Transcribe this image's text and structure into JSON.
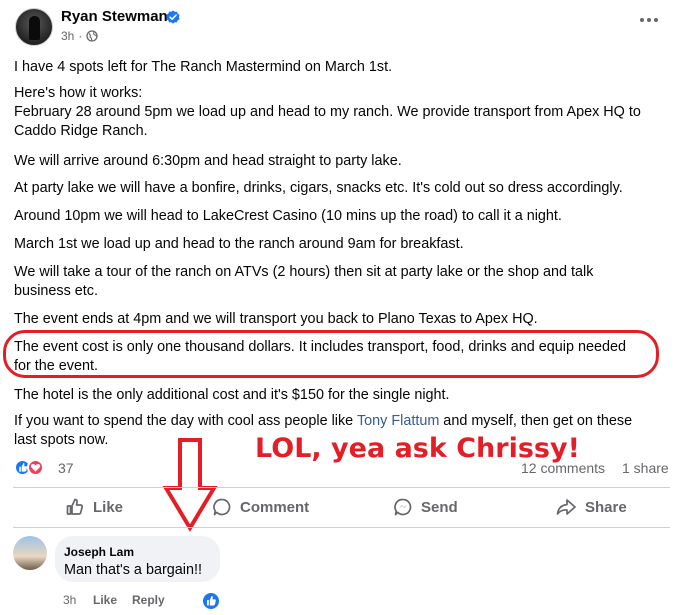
{
  "post": {
    "author": "Ryan Stewman",
    "time": "3h",
    "paragraphs": [
      [
        "I have 4 spots left for The Ranch Mastermind on March 1st."
      ],
      [
        "Here's how it works:",
        "February 28 around 5pm we load up and head to my ranch. We provide transport from Apex HQ to",
        "Caddo Ridge Ranch."
      ],
      [
        "We will arrive around 6:30pm and head straight to party lake."
      ],
      [
        "At party lake we will have a bonfire, drinks, cigars, snacks etc. It's cold out so dress accordingly."
      ],
      [
        "Around 10pm we will head to LakeCrest Casino (10 mins up the road) to call it a night."
      ],
      [
        "March 1st we load up and head to the ranch around 9am for breakfast."
      ],
      [
        "We will take a tour of the ranch on ATVs (2 hours) then sit at party lake or the shop and talk",
        "business etc."
      ],
      [
        "The event ends at 4pm and we will transport you back to Plano Texas to Apex HQ."
      ],
      [
        "The event cost is only one thousand dollars. It includes transport, food, drinks and equip needed",
        "for the event."
      ],
      [
        "The hotel is the only additional cost and it's $150 for the single night."
      ]
    ],
    "last_paragraph": {
      "before": "If you want to spend the day with cool ass people like ",
      "mention": "Tony Flattum",
      "after": " and myself, then get on these",
      "line2": "last spots now."
    }
  },
  "annotation": {
    "text": "LOL, yea ask Chrissy!",
    "color": "#e41e26"
  },
  "stats": {
    "reactions": "37",
    "comments": "12 comments",
    "shares": "1 share"
  },
  "actions": {
    "like": "Like",
    "comment": "Comment",
    "send": "Send",
    "share": "Share"
  },
  "comment": {
    "author": "Joseph Lam",
    "text": "Man that's a bargain!!",
    "time": "3h",
    "like": "Like",
    "reply": "Reply"
  },
  "colors": {
    "facebook_blue": "#1877f2",
    "secondary_text": "#65676b",
    "mention": "#385898",
    "love_red": "#f33e58"
  },
  "icons": [
    "verified-badge-icon",
    "globe-icon",
    "more-options-icon",
    "like-reaction-icon",
    "love-reaction-icon",
    "thumbs-up-icon",
    "comment-icon",
    "send-icon",
    "share-icon",
    "down-arrow-icon"
  ]
}
